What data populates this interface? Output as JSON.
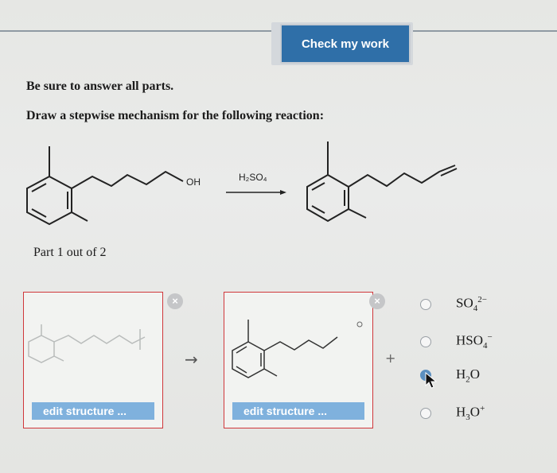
{
  "header": {
    "check_button": "Check my work"
  },
  "instructions": {
    "line1": "Be sure to answer all parts.",
    "line2": "Draw a stepwise mechanism for the following reaction:"
  },
  "reaction": {
    "reactant_group": "OH",
    "reagent": "H₂SO₄"
  },
  "part": {
    "label": "Part 1 out of 2"
  },
  "workspace": {
    "box1_button": "edit structure ...",
    "box2_button": "edit structure ...",
    "remove_glyph": "×",
    "arrow_glyph": "→",
    "plus_glyph": "+"
  },
  "options": [
    {
      "base": "SO",
      "sub": "4",
      "sup": "2−",
      "selected": false
    },
    {
      "base": "HSO",
      "sub": "4",
      "sup": "−",
      "selected": false
    },
    {
      "base": "H",
      "sub": "2",
      "tail": "O",
      "selected": true
    },
    {
      "base": "H",
      "sub": "3",
      "tail": "O",
      "sup": "+",
      "selected": false
    }
  ],
  "colors": {
    "accent": "#2f6fa8",
    "box_border": "#d0373b",
    "edit_button": "#7fb1dd"
  }
}
